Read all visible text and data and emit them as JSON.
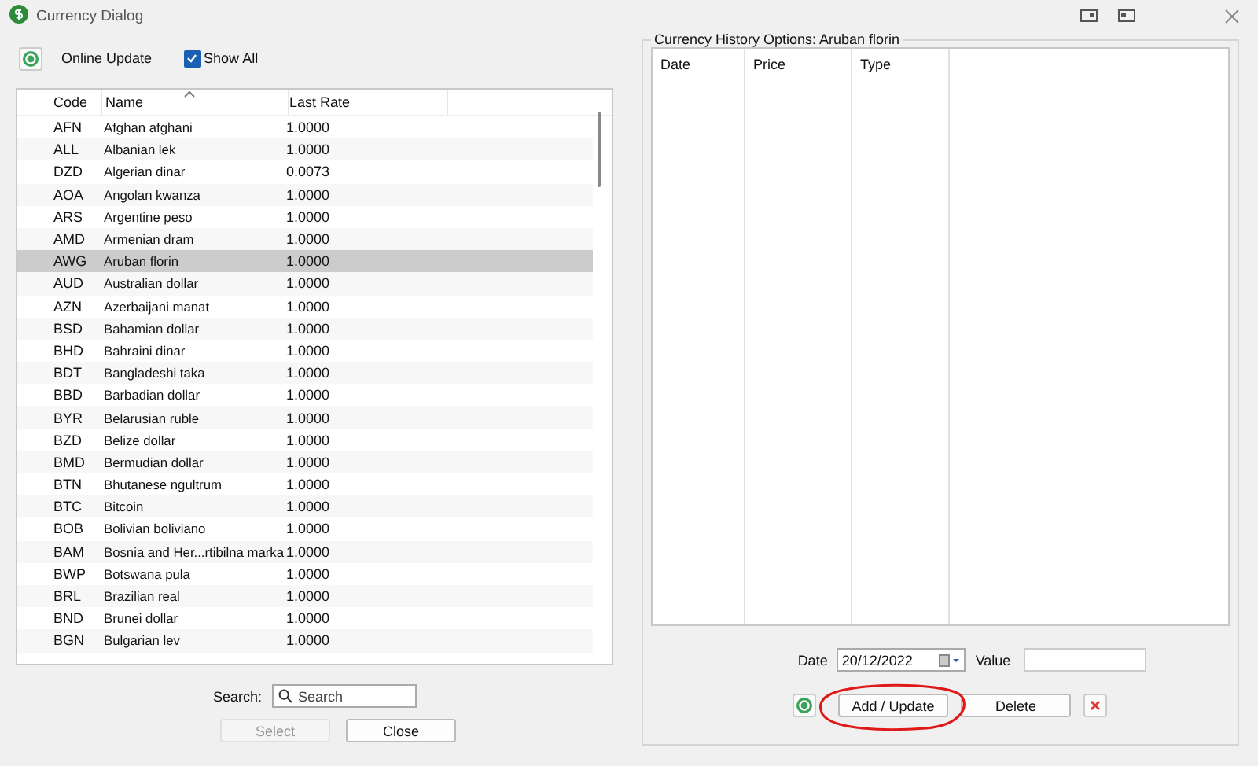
{
  "window": {
    "title": "Currency Dialog"
  },
  "toolbar": {
    "online_update": "Online Update",
    "show_all": {
      "label": "Show All",
      "checked": true
    }
  },
  "currency_table": {
    "columns": [
      "Code",
      "Name",
      "Last Rate"
    ],
    "rows": [
      {
        "code": "AFN",
        "name": "Afghan afghani",
        "rate": "1.0000",
        "selected": false
      },
      {
        "code": "ALL",
        "name": "Albanian lek",
        "rate": "1.0000",
        "selected": false
      },
      {
        "code": "DZD",
        "name": "Algerian dinar",
        "rate": "0.0073",
        "selected": false
      },
      {
        "code": "AOA",
        "name": "Angolan kwanza",
        "rate": "1.0000",
        "selected": false
      },
      {
        "code": "ARS",
        "name": "Argentine peso",
        "rate": "1.0000",
        "selected": false
      },
      {
        "code": "AMD",
        "name": "Armenian dram",
        "rate": "1.0000",
        "selected": false
      },
      {
        "code": "AWG",
        "name": "Aruban florin",
        "rate": "1.0000",
        "selected": true
      },
      {
        "code": "AUD",
        "name": "Australian dollar",
        "rate": "1.0000",
        "selected": false
      },
      {
        "code": "AZN",
        "name": "Azerbaijani manat",
        "rate": "1.0000",
        "selected": false
      },
      {
        "code": "BSD",
        "name": "Bahamian dollar",
        "rate": "1.0000",
        "selected": false
      },
      {
        "code": "BHD",
        "name": "Bahraini dinar",
        "rate": "1.0000",
        "selected": false
      },
      {
        "code": "BDT",
        "name": "Bangladeshi taka",
        "rate": "1.0000",
        "selected": false
      },
      {
        "code": "BBD",
        "name": "Barbadian dollar",
        "rate": "1.0000",
        "selected": false
      },
      {
        "code": "BYR",
        "name": "Belarusian ruble",
        "rate": "1.0000",
        "selected": false
      },
      {
        "code": "BZD",
        "name": "Belize dollar",
        "rate": "1.0000",
        "selected": false
      },
      {
        "code": "BMD",
        "name": "Bermudian dollar",
        "rate": "1.0000",
        "selected": false
      },
      {
        "code": "BTN",
        "name": "Bhutanese ngultrum",
        "rate": "1.0000",
        "selected": false
      },
      {
        "code": "BTC",
        "name": "Bitcoin",
        "rate": "1.0000",
        "selected": false
      },
      {
        "code": "BOB",
        "name": "Bolivian boliviano",
        "rate": "1.0000",
        "selected": false
      },
      {
        "code": "BAM",
        "name": "Bosnia and Her...rtibilna marka",
        "rate": "1.0000",
        "selected": false
      },
      {
        "code": "BWP",
        "name": "Botswana pula",
        "rate": "1.0000",
        "selected": false
      },
      {
        "code": "BRL",
        "name": "Brazilian real",
        "rate": "1.0000",
        "selected": false
      },
      {
        "code": "BND",
        "name": "Brunei dollar",
        "rate": "1.0000",
        "selected": false
      },
      {
        "code": "BGN",
        "name": "Bulgarian lev",
        "rate": "1.0000",
        "selected": false
      }
    ]
  },
  "search": {
    "label": "Search:",
    "placeholder": "Search"
  },
  "left_buttons": [
    {
      "label": "Select",
      "disabled": true
    },
    {
      "label": "Close",
      "disabled": false
    }
  ],
  "history": {
    "title": "Currency History Options: Aruban florin",
    "columns": [
      "Date",
      "Price",
      "Type"
    ],
    "date_label": "Date",
    "date_value": "20/12/2022",
    "value_label": "Value",
    "buttons": [
      "Add / Update",
      "Delete"
    ]
  }
}
